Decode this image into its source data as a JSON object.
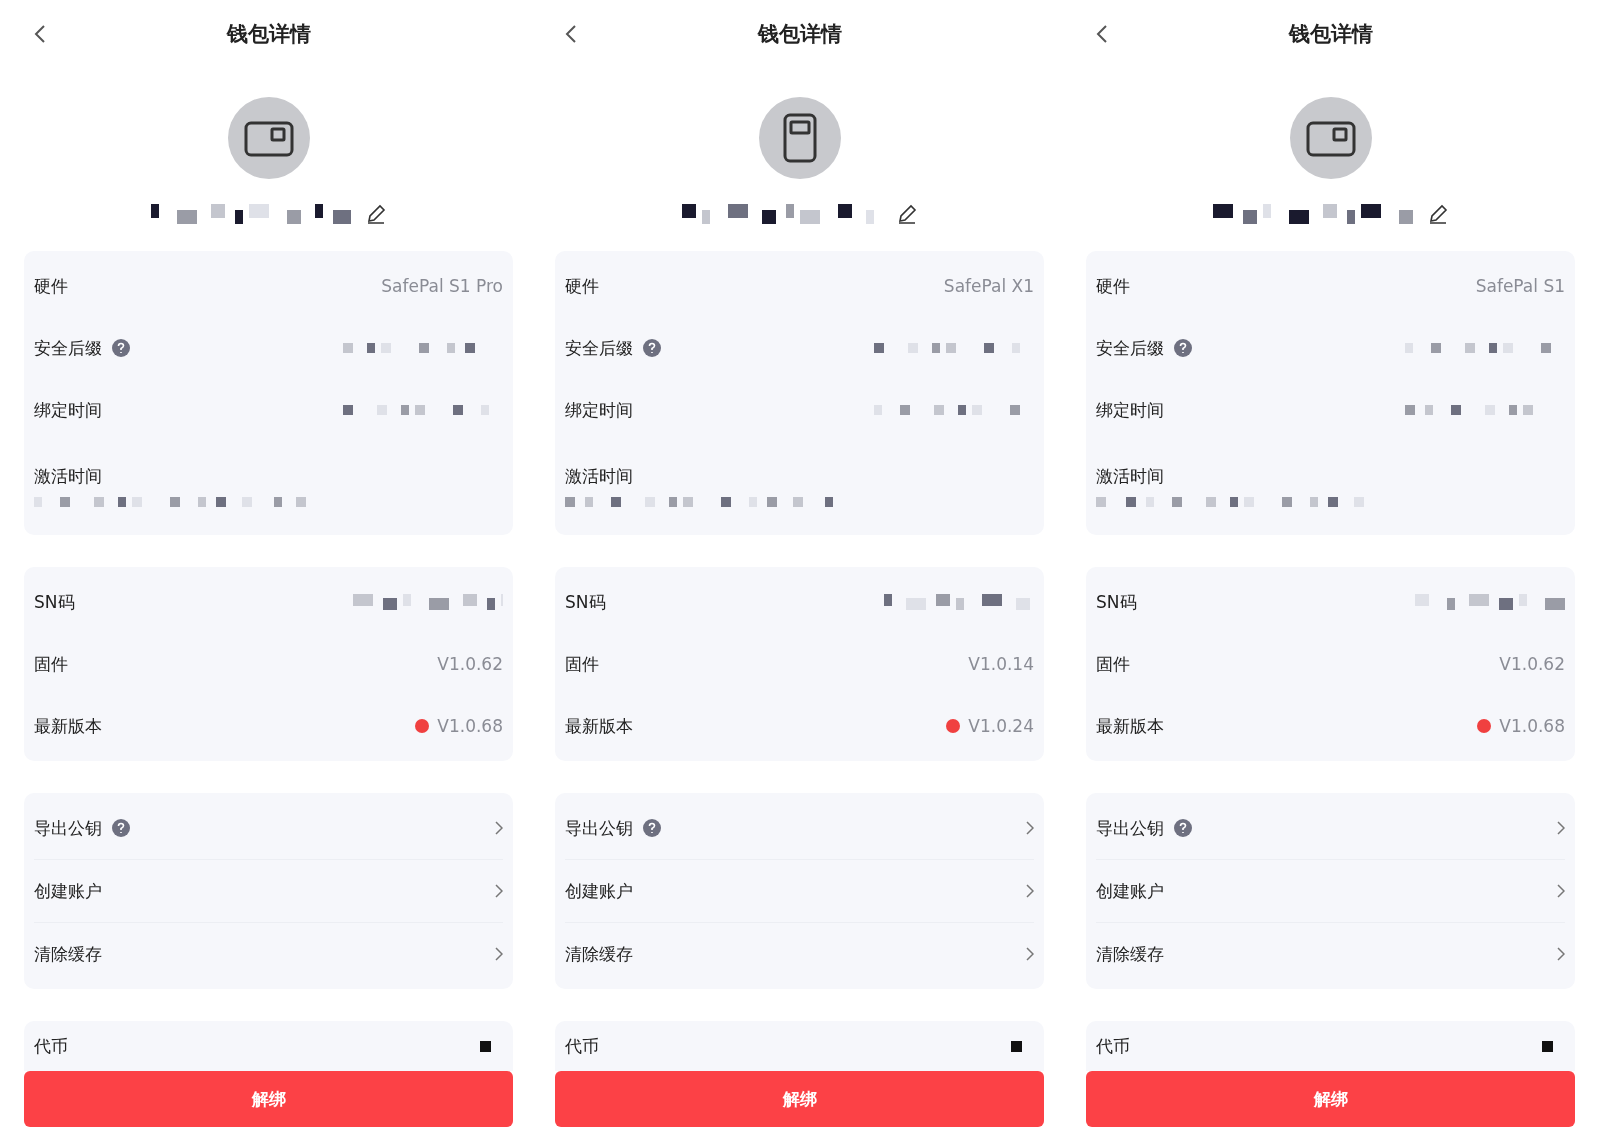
{
  "panels": [
    {
      "title": "钱包详情",
      "avatar": {
        "kind": "landscape"
      },
      "info": [
        {
          "label": "硬件",
          "kind": "text",
          "value": "SafePal S1 Pro"
        },
        {
          "label": "安全后缀",
          "kind": "redacted",
          "help": true
        },
        {
          "label": "绑定时间",
          "kind": "redacted"
        },
        {
          "label": "激活时间",
          "kind": "redacted_below"
        }
      ],
      "device": [
        {
          "label": "SN码",
          "kind": "redacted"
        },
        {
          "label": "固件",
          "kind": "text",
          "value": "V1.0.62"
        },
        {
          "label": "最新版本",
          "kind": "text",
          "value": "V1.0.68",
          "update_available": true
        }
      ],
      "actions": [
        {
          "label": "导出公钥",
          "help": true
        },
        {
          "label": "创建账户"
        },
        {
          "label": "清除缓存"
        }
      ],
      "tokens": {
        "label": "代币"
      },
      "button": "解绑"
    },
    {
      "title": "钱包详情",
      "avatar": {
        "kind": "portrait"
      },
      "info": [
        {
          "label": "硬件",
          "kind": "text",
          "value": "SafePal X1"
        },
        {
          "label": "安全后缀",
          "kind": "redacted",
          "help": true
        },
        {
          "label": "绑定时间",
          "kind": "redacted"
        },
        {
          "label": "激活时间",
          "kind": "redacted_below"
        }
      ],
      "device": [
        {
          "label": "SN码",
          "kind": "redacted"
        },
        {
          "label": "固件",
          "kind": "text",
          "value": "V1.0.14"
        },
        {
          "label": "最新版本",
          "kind": "text",
          "value": "V1.0.24",
          "update_available": true
        }
      ],
      "actions": [
        {
          "label": "导出公钥",
          "help": true
        },
        {
          "label": "创建账户"
        },
        {
          "label": "清除缓存"
        }
      ],
      "tokens": {
        "label": "代币"
      },
      "button": "解绑"
    },
    {
      "title": "钱包详情",
      "avatar": {
        "kind": "landscape"
      },
      "info": [
        {
          "label": "硬件",
          "kind": "text",
          "value": "SafePal S1"
        },
        {
          "label": "安全后缀",
          "kind": "redacted",
          "help": true
        },
        {
          "label": "绑定时间",
          "kind": "redacted"
        },
        {
          "label": "激活时间",
          "kind": "redacted_below"
        }
      ],
      "device": [
        {
          "label": "SN码",
          "kind": "redacted"
        },
        {
          "label": "固件",
          "kind": "text",
          "value": "V1.0.62"
        },
        {
          "label": "最新版本",
          "kind": "text",
          "value": "V1.0.68",
          "update_available": true
        }
      ],
      "actions": [
        {
          "label": "导出公钥",
          "help": true
        },
        {
          "label": "创建账户"
        },
        {
          "label": "清除缓存"
        }
      ],
      "tokens": {
        "label": "代币"
      },
      "button": "解绑"
    }
  ]
}
